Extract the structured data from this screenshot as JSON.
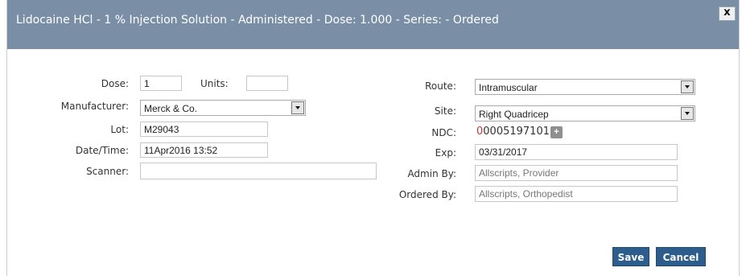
{
  "dialog": {
    "title": "Lidocaine HCl - 1 % Injection Solution - Administered - Dose: 1.000 - Series: - Ordered",
    "close_label": "x"
  },
  "form": {
    "dose": {
      "label": "Dose:",
      "value": "1"
    },
    "units": {
      "label": "Units:",
      "value": ""
    },
    "manufacturer": {
      "label": "Manufacturer:",
      "value": "Merck & Co."
    },
    "lot": {
      "label": "Lot:",
      "value": "M29043"
    },
    "datetime": {
      "label": "Date/Time:",
      "value": "11Apr2016 13:52"
    },
    "scanner": {
      "label": "Scanner:",
      "value": ""
    },
    "route": {
      "label": "Route:",
      "value": "Intramuscular"
    },
    "site": {
      "label": "Site:",
      "value": "Right Quadricep"
    },
    "ndc": {
      "label": "NDC:",
      "prefix": "0",
      "value": "0005197101",
      "add_label": "+"
    },
    "exp": {
      "label": "Exp:",
      "value": "03/31/2017"
    },
    "admin_by": {
      "label": "Admin By:",
      "value": "Allscripts, Provider"
    },
    "ordered_by": {
      "label": "Ordered By:",
      "value": "Allscripts, Orthopedist"
    }
  },
  "buttons": {
    "save": "Save",
    "cancel": "Cancel"
  },
  "colors": {
    "titlebar": "#7a8fa6",
    "button": "#2d5d8c",
    "ndc_prefix": "#c0392b"
  }
}
